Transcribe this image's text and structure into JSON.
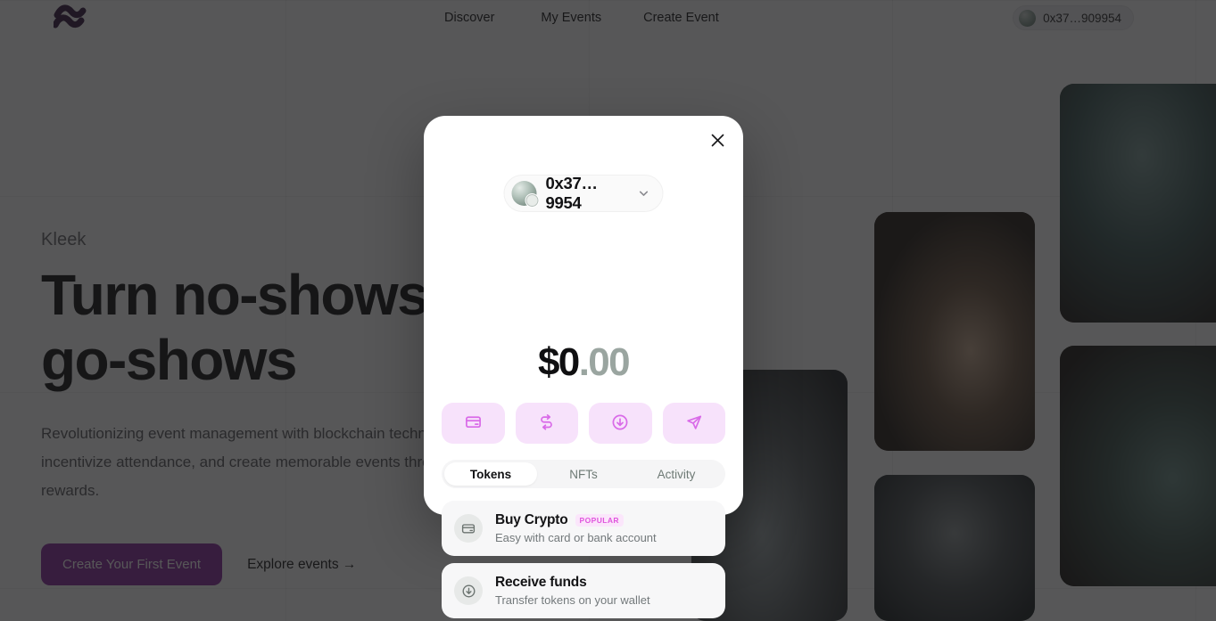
{
  "header": {
    "logo_icon": "kleek-wave-logo",
    "nav": [
      {
        "label": "Discover"
      },
      {
        "label": "My Events"
      },
      {
        "label": "Create Event"
      }
    ],
    "wallet": {
      "address": "0x37…909954",
      "avatar_icon": "wallet-avatar"
    }
  },
  "hero": {
    "eyebrow": "Kleek",
    "headline": "Turn no-shows into\ngo-shows",
    "subcopy": "Revolutionizing event management with blockchain technology. Reduce no-shows, incentivize attendance, and create memorable events through smart deposits and rewards.",
    "primary_cta": "Create Your First Event",
    "secondary_cta": "Explore events →",
    "primary_cta_color": "#8b2fa0"
  },
  "gallery": [
    {
      "name": "photo-woman-laptop"
    },
    {
      "name": "photo-man-tablet-patio"
    },
    {
      "name": "photo-woman-couch-coffee"
    },
    {
      "name": "photo-studio-workshop"
    },
    {
      "name": "photo-office-meeting"
    }
  ],
  "modal": {
    "close_icon": "close-icon",
    "account": {
      "address": "0x37…9954",
      "avatar_icon": "wallet-avatar",
      "chevron_icon": "chevron-down-icon"
    },
    "balance": {
      "main": "$0",
      "cents": ".00"
    },
    "actions": [
      {
        "name": "buy-action",
        "icon": "credit-card-icon"
      },
      {
        "name": "swap-action",
        "icon": "swap-arrows-icon"
      },
      {
        "name": "receive-action",
        "icon": "arrow-down-circle-icon"
      },
      {
        "name": "send-action",
        "icon": "paper-plane-icon"
      }
    ],
    "action_color": "#d96ae8",
    "action_bg": "#f7e2fb",
    "tabs": [
      {
        "label": "Tokens",
        "active": true
      },
      {
        "label": "NFTs",
        "active": false
      },
      {
        "label": "Activity",
        "active": false
      }
    ],
    "options": [
      {
        "title": "Buy Crypto",
        "badge": "POPULAR",
        "subtitle": "Easy with card or bank account",
        "icon": "credit-card-icon"
      },
      {
        "title": "Receive funds",
        "badge": "",
        "subtitle": "Transfer tokens on your wallet",
        "icon": "arrow-down-circle-icon"
      }
    ]
  }
}
